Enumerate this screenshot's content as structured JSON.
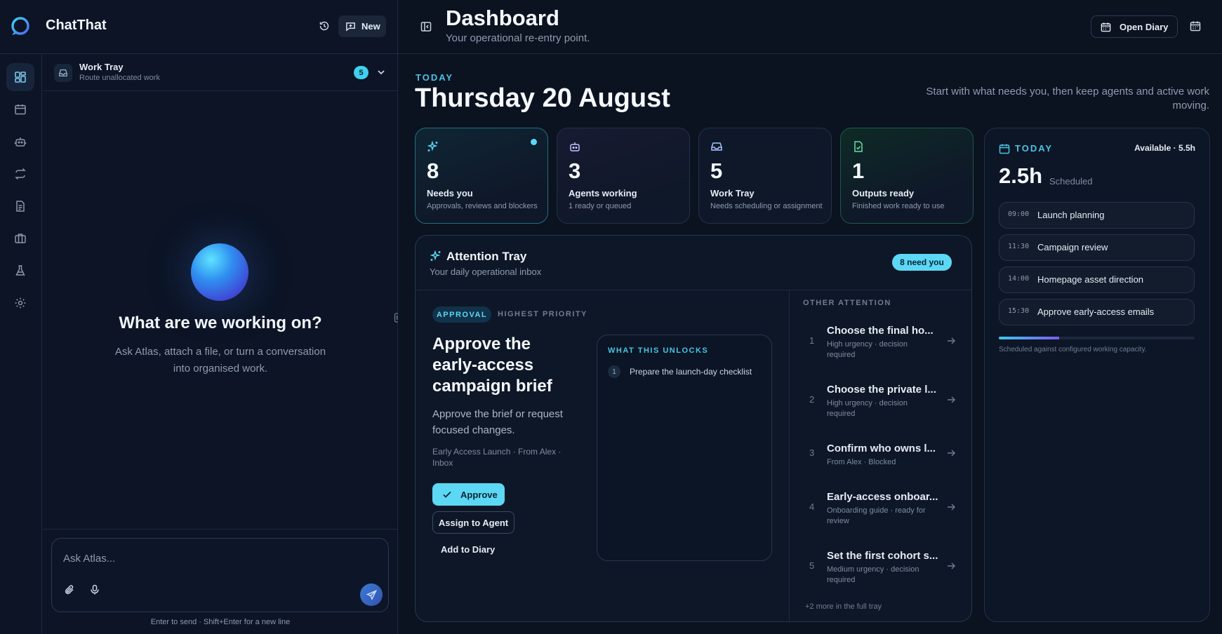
{
  "app": {
    "title": "ChatThat",
    "new_label": "New"
  },
  "rail": [
    "dashboard",
    "diary",
    "agents",
    "workflows",
    "documents",
    "portfolio",
    "lab",
    "settings"
  ],
  "work_tray": {
    "title": "Work Tray",
    "subtitle": "Route unallocated work",
    "count": "5"
  },
  "hero": {
    "title": "What are we working on?",
    "subtitle": "Ask Atlas, attach a file, or turn a conversation into organised work."
  },
  "composer": {
    "placeholder": "Ask Atlas...",
    "hint": "Enter to send · Shift+Enter for a new line"
  },
  "header": {
    "title": "Dashboard",
    "subtitle": "Your operational re-entry point.",
    "open_diary_label": "Open Diary"
  },
  "today": {
    "label": "TODAY",
    "date": "Thursday 20 August",
    "tagline": "Start with what needs you, then keep agents and active work moving."
  },
  "stats": [
    {
      "number": "8",
      "label": "Needs you",
      "sub": "Approvals, reviews and blockers",
      "icon": "sparkle-icon",
      "color": "#5cd8f5"
    },
    {
      "number": "3",
      "label": "Agents working",
      "sub": "1 ready or queued",
      "icon": "bot-icon",
      "color": "#c7c3ff"
    },
    {
      "number": "5",
      "label": "Work Tray",
      "sub": "Needs scheduling or assignment",
      "icon": "inbox-icon",
      "color": "#a9c2ff"
    },
    {
      "number": "1",
      "label": "Outputs ready",
      "sub": "Finished work ready to use",
      "icon": "file-check-icon",
      "color": "#66e0a3"
    }
  ],
  "attention": {
    "title": "Attention Tray",
    "subtitle": "Your daily operational inbox",
    "pill": "8 need you",
    "featured": {
      "badge": "APPROVAL",
      "priority": "HIGHEST PRIORITY",
      "title": "Approve the early-access campaign brief",
      "description": "Approve the brief or request focused changes.",
      "meta": "Early Access Launch · From Alex · Inbox",
      "approve_label": "Approve",
      "assign_label": "Assign to Agent",
      "diary_label": "Add to Diary"
    },
    "unlocks": {
      "title": "WHAT THIS UNLOCKS",
      "items": [
        {
          "num": "1",
          "text": "Prepare the launch-day checklist"
        }
      ]
    },
    "other": {
      "title": "OTHER ATTENTION",
      "items": [
        {
          "num": "1",
          "title": "Choose the final ho...",
          "meta": "High urgency · decision required"
        },
        {
          "num": "2",
          "title": "Choose the private l...",
          "meta": "High urgency · decision required"
        },
        {
          "num": "3",
          "title": "Confirm who owns l...",
          "meta": "From Alex · Blocked"
        },
        {
          "num": "4",
          "title": "Early-access onboar...",
          "meta": "Onboarding guide · ready for review"
        },
        {
          "num": "5",
          "title": "Set the first cohort s...",
          "meta": "Medium urgency · decision required"
        }
      ],
      "more": "+2 more in the full tray"
    }
  },
  "today_panel": {
    "label": "TODAY",
    "available": "Available · 5.5h",
    "hours": "2.5h",
    "scheduled": "Scheduled",
    "slots": [
      {
        "time": "09:00",
        "title": "Launch planning"
      },
      {
        "time": "11:30",
        "title": "Campaign review"
      },
      {
        "time": "14:00",
        "title": "Homepage asset direction"
      },
      {
        "time": "15:30",
        "title": "Approve early-access emails"
      }
    ],
    "capacity_fraction": 0.31,
    "capacity_note": "Scheduled against configured working capacity."
  }
}
